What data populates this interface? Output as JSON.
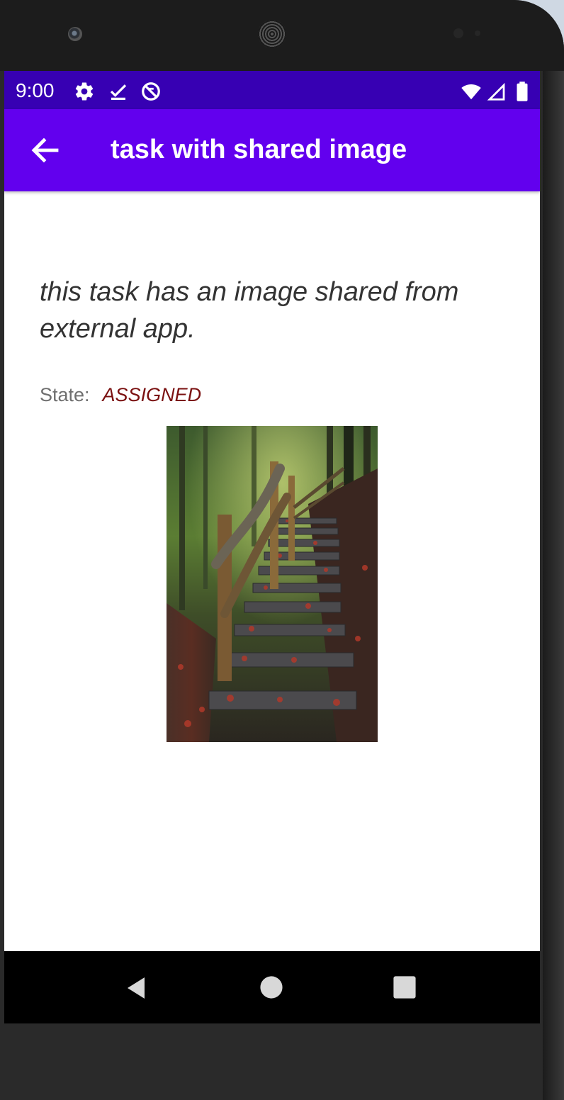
{
  "status_bar": {
    "time": "9:00",
    "left_icons": [
      "gear-icon",
      "download-done-icon",
      "do-not-disturb-icon"
    ],
    "right_icons": [
      "wifi-icon",
      "cell-signal-icon",
      "battery-icon"
    ]
  },
  "app_bar": {
    "title": "task with shared image",
    "back_icon": "arrow-back-icon"
  },
  "task": {
    "description": "this task has an image shared from external app.",
    "state_label": "State:",
    "state_value": "ASSIGNED"
  },
  "navigation_bar": {
    "buttons": [
      "back-triangle-icon",
      "home-circle-icon",
      "recents-square-icon"
    ]
  },
  "colors": {
    "status_bar": "#3700b3",
    "app_bar": "#6200ee",
    "state_value": "#7a1010"
  }
}
